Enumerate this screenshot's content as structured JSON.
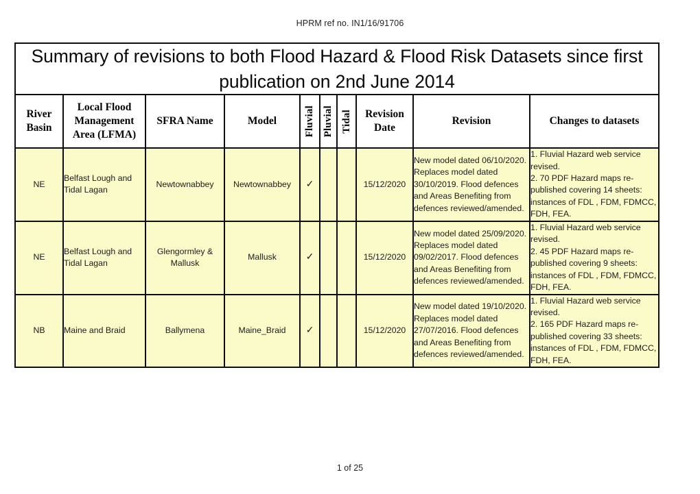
{
  "document": {
    "hprm_ref": "HPRM ref no. IN1/16/91706",
    "page_footer": "1 of 25",
    "title": "Summary of revisions to both Flood Hazard & Flood Risk Datasets since first publication on 2nd June 2014"
  },
  "colors": {
    "cell_fill": "#FBFAC9",
    "border": "#0D0D0D",
    "text": "#1C1C1C",
    "page_background": "#FFFFFF"
  },
  "table": {
    "headers": {
      "river_basin": "River Basin",
      "lfma": "Local Flood Management Area (LFMA)",
      "sfra_name": "SFRA Name",
      "model": "Model",
      "fluvial": "Fluvial",
      "pluvial": "Pluvial",
      "tidal": "Tidal",
      "revision_date": "Revision Date",
      "revision": "Revision",
      "changes": "Changes to datasets"
    },
    "tick_glyph": "✓",
    "rows": [
      {
        "river_basin": "NE",
        "lfma": "Belfast Lough and Tidal Lagan",
        "sfra_name": "Newtownabbey",
        "model": "Newtownabbey",
        "fluvial": "✓",
        "pluvial": "",
        "tidal": "",
        "revision_date": "15/12/2020",
        "revision": "New model dated 06/10/2020. Replaces model dated 30/10/2019. Flood defences and Areas Benefiting from defences reviewed/amended.",
        "changes": "1. Fluvial Hazard web service revised.\n2.  70 PDF Hazard maps re-published covering 14 sheets: instances of FDL , FDM, FDMCC, FDH, FEA."
      },
      {
        "river_basin": "NE",
        "lfma": "Belfast Lough and Tidal Lagan",
        "sfra_name": "Glengormley & Mallusk",
        "model": "Mallusk",
        "fluvial": "✓",
        "pluvial": "",
        "tidal": "",
        "revision_date": "15/12/2020",
        "revision": "New model dated 25/09/2020. Replaces model dated 09/02/2017. Flood defences and Areas Benefiting from defences reviewed/amended.",
        "changes": "1. Fluvial Hazard web service revised.\n2.  45 PDF Hazard maps re-published covering 9 sheets: instances of FDL , FDM, FDMCC, FDH, FEA."
      },
      {
        "river_basin": "NB",
        "lfma": "Maine and Braid",
        "sfra_name": "Ballymena",
        "model": "Maine_Braid",
        "fluvial": "✓",
        "pluvial": "",
        "tidal": "",
        "revision_date": "15/12/2020",
        "revision": "New model dated 19/10/2020. Replaces model dated 27/07/2016. Flood defences and Areas Benefiting from defences reviewed/amended.",
        "changes": "1. Fluvial Hazard web service revised.\n2.  165 PDF Hazard maps re-published covering 33 sheets: instances of FDL , FDM, FDMCC, FDH, FEA."
      }
    ]
  }
}
